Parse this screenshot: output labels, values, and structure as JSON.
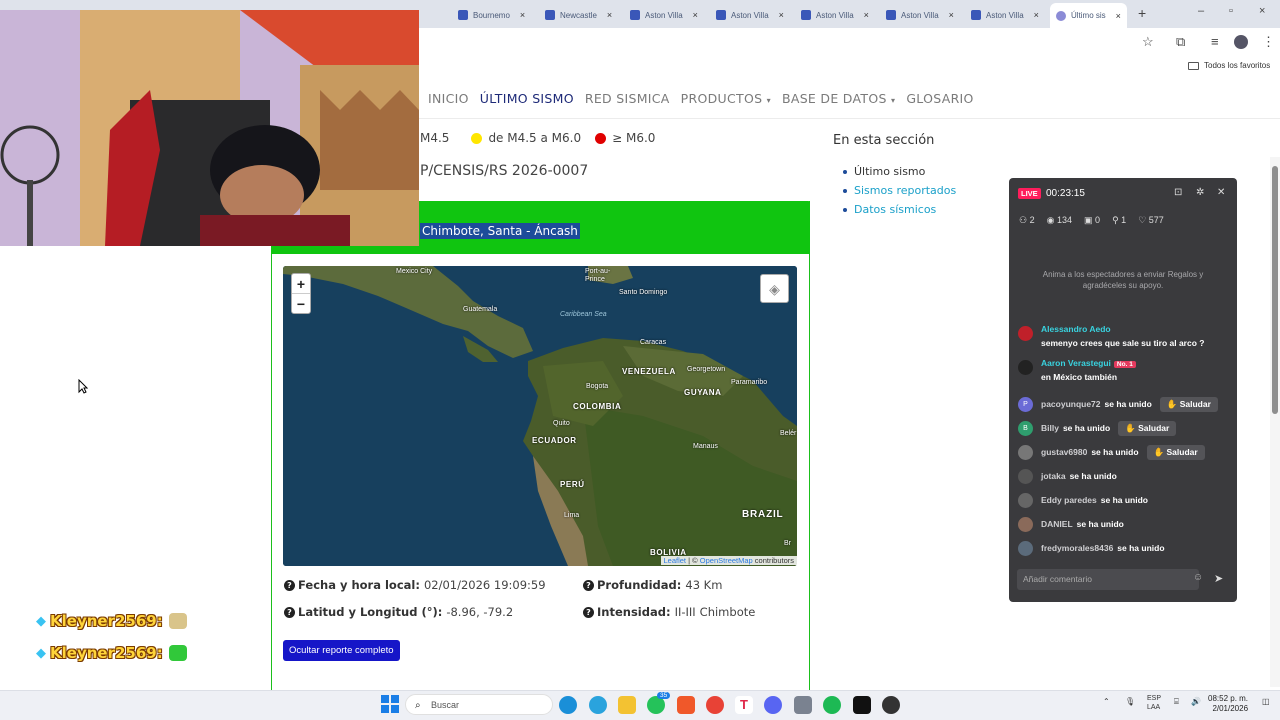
{
  "browser": {
    "tabs": [
      {
        "label": "Bournemo"
      },
      {
        "label": "Newcastle"
      },
      {
        "label": "Aston Villa"
      },
      {
        "label": "Aston Villa"
      },
      {
        "label": "Aston Villa"
      },
      {
        "label": "Aston Villa"
      },
      {
        "label": "Aston Villa"
      },
      {
        "label": "Último sis"
      }
    ],
    "bookmarks_label": "Todos los favoritos"
  },
  "site_nav": {
    "items": [
      {
        "label": "INICIO",
        "active": false
      },
      {
        "label": "ÚLTIMO SISMO",
        "active": true
      },
      {
        "label": "RED SISMICA",
        "active": false
      },
      {
        "label": "PRODUCTOS",
        "active": false,
        "caret": "▾"
      },
      {
        "label": "BASE DE DATOS",
        "active": false,
        "caret": "▾"
      },
      {
        "label": "GLOSARIO",
        "active": false
      }
    ]
  },
  "magnitude_legend": {
    "partial_label": "M4.5",
    "mid_label": "de M4.5 a M6.0",
    "high_label": "≥ M6.0",
    "colors": {
      "mid": "#ffe600",
      "high": "#e00000"
    }
  },
  "report": {
    "code_partial": "P/CENSIS/RS 2026-0007",
    "place": "Chimbote, Santa - Áncash",
    "header_color": "#10c510",
    "date_label": "Fecha y hora local:",
    "date_value": "02/01/2026 19:09:59",
    "depth_label": "Profundidad:",
    "depth_value": "43 Km",
    "coords_label": "Latitud y Longitud (°):",
    "coords_value": "-8.96, -79.2",
    "intensity_label": "Intensidad:",
    "intensity_value": "II-III",
    "intensity_place": "Chimbote",
    "hide_button": "Ocultar reporte completo"
  },
  "map": {
    "zoom_in": "+",
    "zoom_out": "−",
    "attribution_leaflet": "Leaflet",
    "attribution_sep": " | © ",
    "attribution_osm": "OpenStreetMap",
    "attribution_tail": " contributors",
    "labels": {
      "mexico_city": "Mexico City",
      "guatemala": "Guatemala",
      "port_au_prince": "Port-au-\nPrince",
      "santo_domingo": "Santo Domingo",
      "caribbean_sea": "Caribbean Sea",
      "caracas": "Caracas",
      "georgetown": "Georgetown",
      "paramaribo": "Paramaribo",
      "venezuela": "VENEZUELA",
      "guyana": "GUYANA",
      "bogota": "Bogota",
      "colombia": "COLOMBIA",
      "quito": "Quito",
      "ecuador": "ECUADOR",
      "manaus": "Manaus",
      "belem": "Belér",
      "peru": "PERÚ",
      "lima": "Lima",
      "brazil": "BRAZIL",
      "bolivia": "BOLIVIA",
      "brasilia": "Br"
    }
  },
  "sidebar": {
    "title": "En esta sección",
    "items": [
      {
        "label": "Último sismo",
        "link": false
      },
      {
        "label": "Sismos reportados",
        "link": true
      },
      {
        "label": "Datos sísmicos",
        "link": true
      }
    ]
  },
  "live_panel": {
    "badge": "LIVE",
    "timer": "00:23:15",
    "stats": {
      "users": "2",
      "views": "134",
      "gifts": "0",
      "follows": "1",
      "likes": "577"
    },
    "hint": "Anima a los espectadores a enviar Regalos y agradéceles su apoyo.",
    "messages": [
      {
        "name": "Alessandro Aedo",
        "text": "semenyo crees que sale su tiro al arco ?"
      },
      {
        "name": "Aaron Verastegui",
        "badge": "No. 1",
        "text": "en México también"
      }
    ],
    "joins": [
      {
        "name": "pacoyunque72",
        "action": "se ha unido",
        "avatar_letter": "P",
        "avatar_color": "#6b6bd6",
        "salute": "Saludar"
      },
      {
        "name": "Billy",
        "action": "se ha unido",
        "avatar_letter": "B",
        "avatar_color": "#2f9e6e",
        "salute": "Saludar"
      },
      {
        "name": "gustav6980",
        "action": "se ha unido",
        "avatar_letter": "",
        "avatar_color": "#777",
        "salute": "Saludar"
      },
      {
        "name": "jotaka",
        "action": "se ha unido",
        "avatar_letter": "",
        "avatar_color": "#555",
        "salute": ""
      },
      {
        "name": "Eddy paredes",
        "action": "se ha unido",
        "avatar_letter": "",
        "avatar_color": "#666",
        "salute": ""
      },
      {
        "name": "DANIEL",
        "action": "se ha unido",
        "avatar_letter": "",
        "avatar_color": "#8a6a5a",
        "salute": ""
      },
      {
        "name": "fredymorales8436",
        "action": "se ha unido",
        "avatar_letter": "",
        "avatar_color": "#5b6b7b",
        "salute": ""
      }
    ],
    "comment_placeholder": "Añadir comentario"
  },
  "stream_overlay": {
    "lines": [
      {
        "user": "Kleyner2569:"
      },
      {
        "user": "Kleyner2569:"
      }
    ]
  },
  "taskbar": {
    "search_label": "Buscar",
    "whatsapp_badge": "35",
    "lang": "ESP\nLAA",
    "time": "08:52 p. m.",
    "date": "2/01/2026"
  }
}
